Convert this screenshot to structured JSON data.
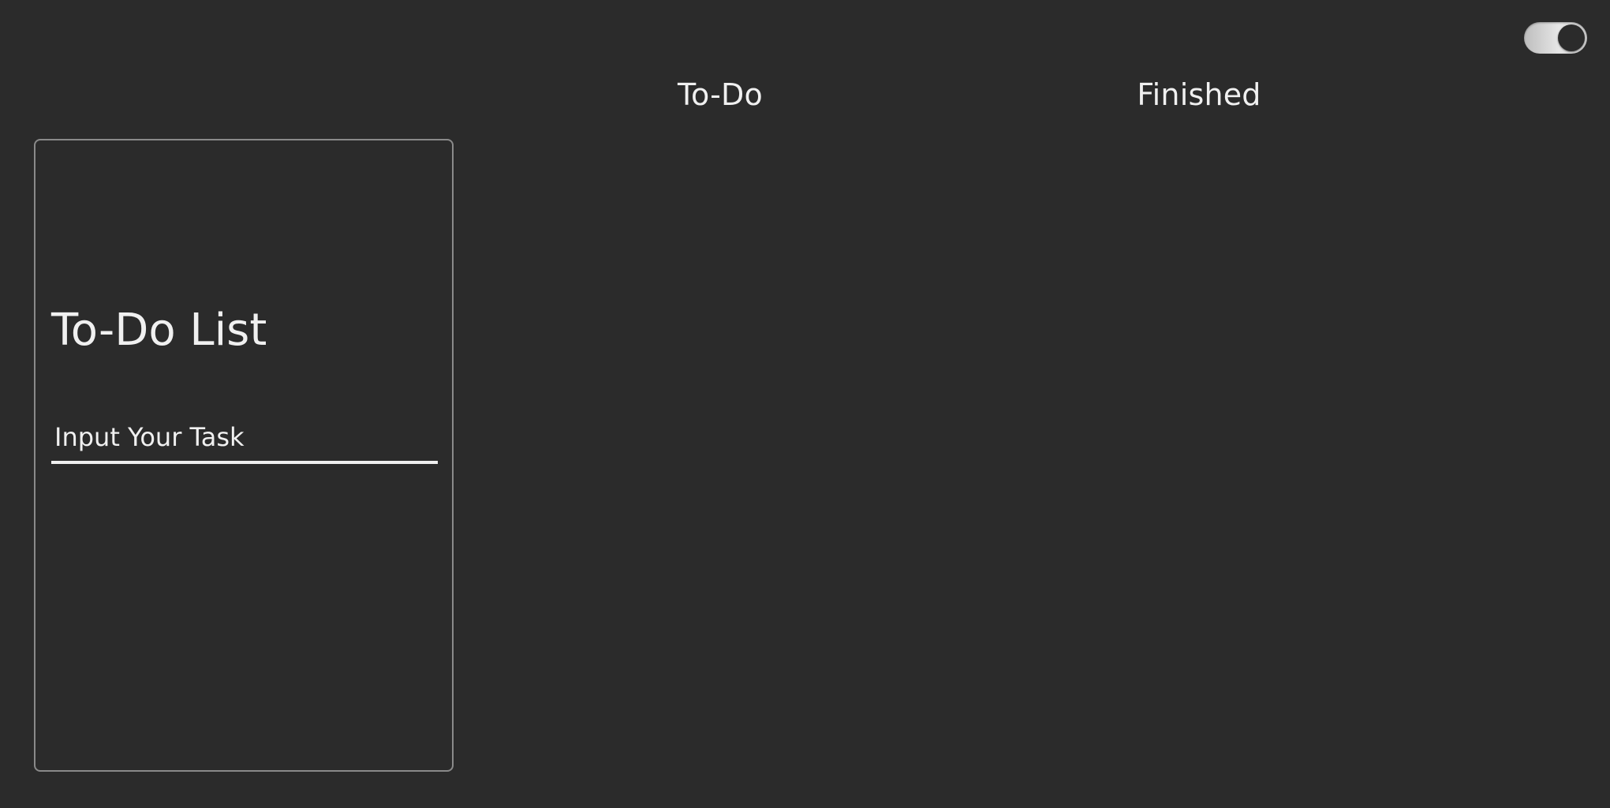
{
  "theme_toggle": {
    "state": "dark",
    "track_color": "#e0e0e0",
    "knob_color": "#2b2b2b"
  },
  "columns": {
    "todo_label": "To-Do",
    "finished_label": "Finished"
  },
  "card": {
    "title": "To-Do List",
    "input_placeholder": "Input Your Task",
    "input_value": ""
  },
  "colors": {
    "background": "#2b2b2b",
    "text": "#f0f0f0",
    "card_border": "#8a8a8a"
  }
}
